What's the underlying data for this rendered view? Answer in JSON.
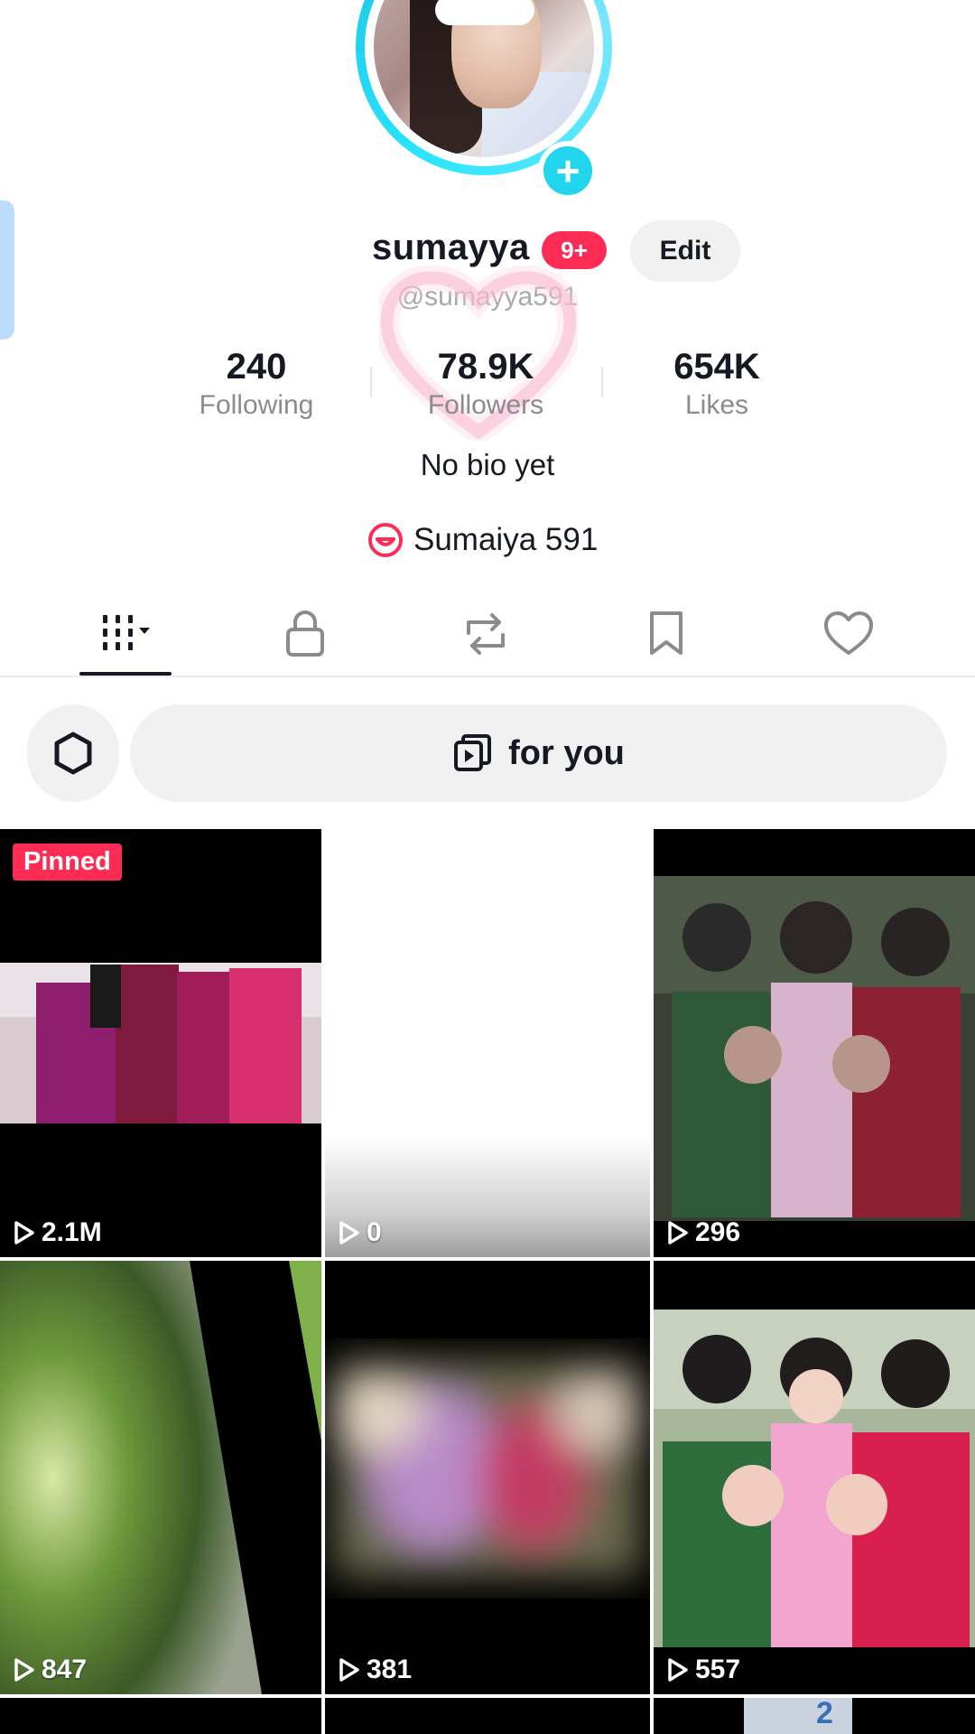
{
  "profile": {
    "username": "sumayya",
    "badge": "9+",
    "edit_label": "Edit",
    "handle": "@sumayya591",
    "bio": "No bio yet",
    "link_text": "Sumaiya 591"
  },
  "stats": [
    {
      "value": "240",
      "label": "Following"
    },
    {
      "value": "78.9K",
      "label": "Followers"
    },
    {
      "value": "654K",
      "label": "Likes"
    }
  ],
  "tabs": [
    {
      "name": "videos",
      "icon": "grid-icon"
    },
    {
      "name": "private",
      "icon": "lock-icon"
    },
    {
      "name": "reposts",
      "icon": "repost-icon"
    },
    {
      "name": "favorites",
      "icon": "bookmark-icon"
    },
    {
      "name": "liked",
      "icon": "heart-icon"
    }
  ],
  "filter": {
    "label": "for you",
    "settings_icon": "settings-icon",
    "playlist_icon": "playlist-icon"
  },
  "videos": [
    {
      "pinned": "Pinned",
      "views": "2.1M"
    },
    {
      "views": "0"
    },
    {
      "views": "296"
    },
    {
      "views": "847"
    },
    {
      "views": "381"
    },
    {
      "views": "557"
    }
  ],
  "partial_cell_text": "2",
  "colors": {
    "accent": "#fe2c55",
    "avatar_ring": "#20d5ec",
    "pill_bg": "#f1f1f2",
    "muted_text": "#8a8b91"
  }
}
